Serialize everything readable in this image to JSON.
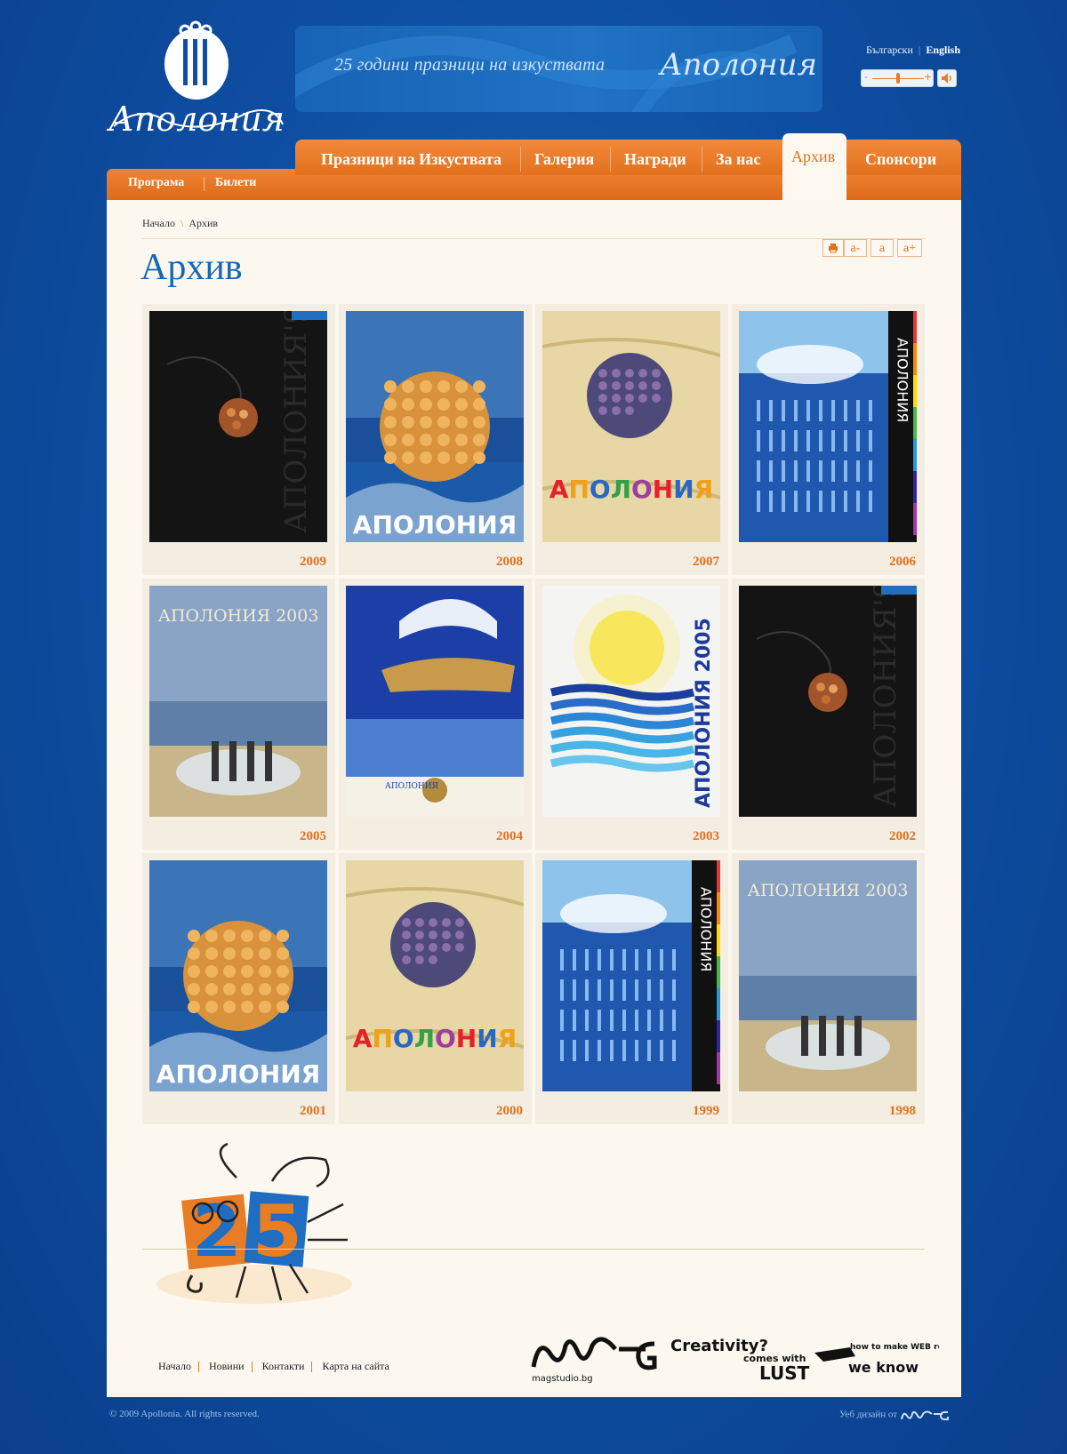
{
  "header": {
    "logo_text": "Аполония",
    "banner_text": "25 години празници на изкуствата",
    "banner_script": "Аполония"
  },
  "languages": {
    "bulgarian": "Български",
    "english": "English"
  },
  "volume": {
    "minus": "-",
    "plus": "+",
    "level": 0.55
  },
  "nav": {
    "items": [
      "Празници на Изкуствата",
      "Галерия",
      "Награди",
      "За нас",
      "Архив",
      "Спонсори"
    ],
    "active": "Архив"
  },
  "subnav": {
    "items": [
      "Програма",
      "Билети"
    ]
  },
  "breadcrumb": {
    "home": "Начало",
    "current": "Архив"
  },
  "page_title": "Архив",
  "tools": {
    "print": "print-icon",
    "smaller": "a-",
    "normal": "a",
    "larger": "a+"
  },
  "posters": [
    {
      "year": "2009",
      "style": "dark"
    },
    {
      "year": "2008",
      "style": "shells",
      "caption": "АПОЛОНИЯ"
    },
    {
      "year": "2007",
      "style": "sand",
      "caption": "АПОЛОНИЯ"
    },
    {
      "year": "2006",
      "style": "rainbow",
      "caption": "АПОЛОНИЯ"
    },
    {
      "year": "2005",
      "style": "sea",
      "caption": "АПОЛОНИЯ 2003"
    },
    {
      "year": "2004",
      "style": "wave",
      "caption": "АПОЛОНИЯ"
    },
    {
      "year": "2003",
      "style": "sun",
      "caption": "АПОЛОНИЯ 2005"
    },
    {
      "year": "2002",
      "style": "dark"
    },
    {
      "year": "2001",
      "style": "shells",
      "caption": "АПОЛОНИЯ"
    },
    {
      "year": "2000",
      "style": "sand",
      "caption": "АПОЛОНИЯ"
    },
    {
      "year": "1999",
      "style": "rainbow",
      "caption": "АПОЛОНИЯ"
    },
    {
      "year": "1998",
      "style": "sea",
      "caption": "АПОЛОНИЯ 2003"
    }
  ],
  "footer_nav": [
    "Начало",
    "Новини",
    "Контакти",
    "Карта на сайта"
  ],
  "credits": {
    "studio": "magstudio.bg",
    "slogan_1": "Creativity?",
    "slogan_2": "comes with",
    "slogan_3": "LUST",
    "slogan_4": "how to make WEB reality",
    "slogan_5": "we know"
  },
  "copyright": "© 2009 Apollonia. All rights reserved.",
  "webdesign": "Уеб дизайн от",
  "colors": {
    "background": "#0e4fa3",
    "accent": "#e2701d",
    "title": "#1667ba",
    "content_bg": "#fcf8ef"
  }
}
